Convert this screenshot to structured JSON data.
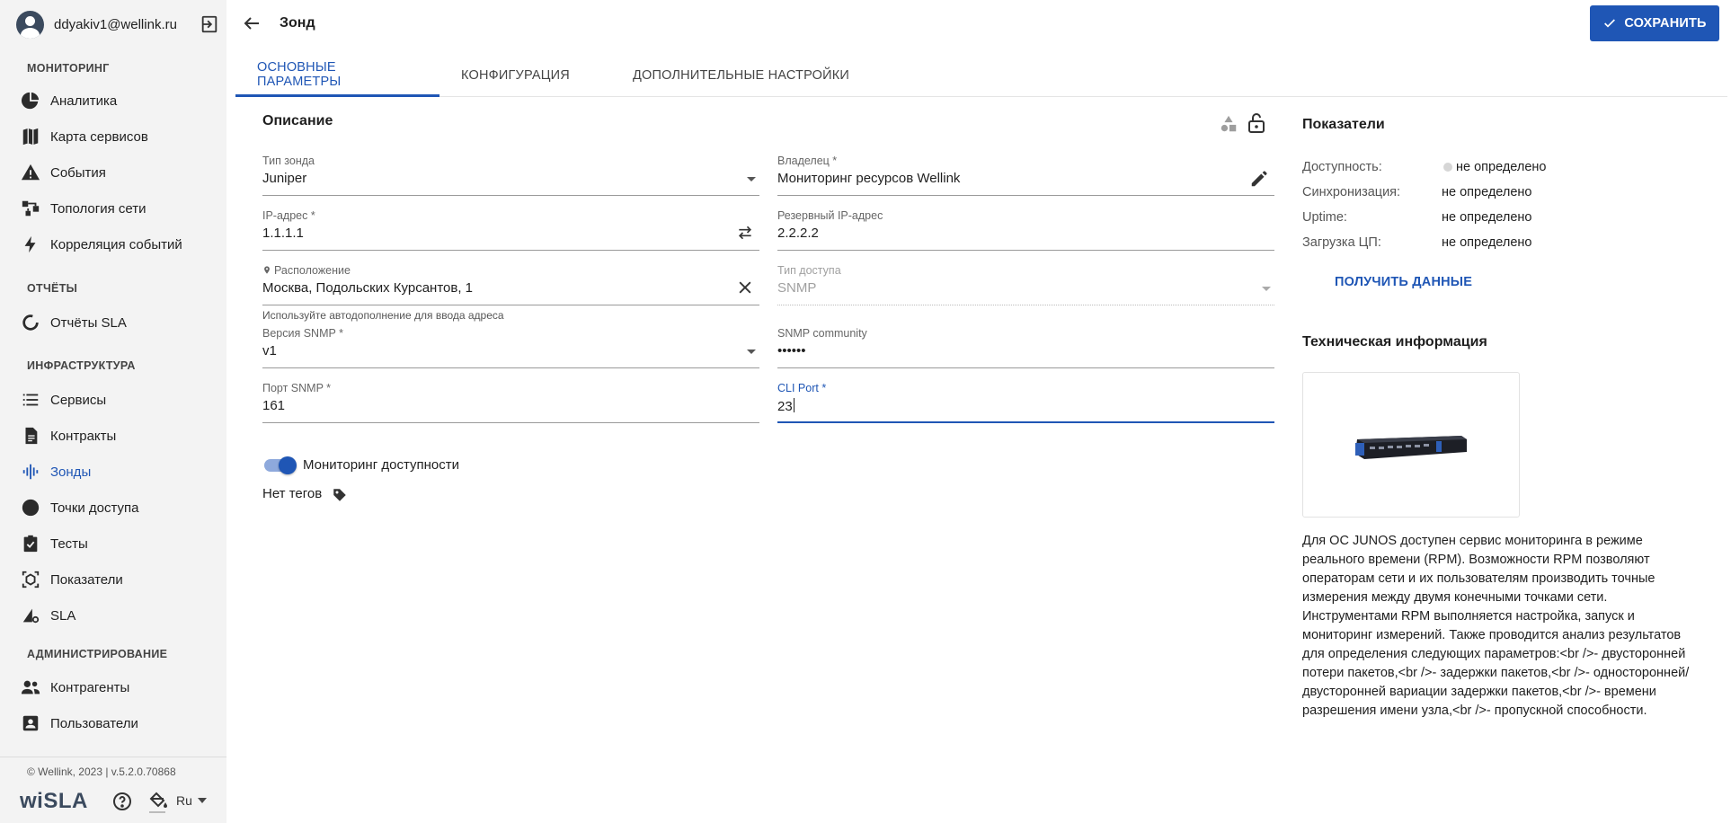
{
  "user": {
    "email": "ddyakiv1@wellink.ru"
  },
  "sidebar": {
    "sections": [
      {
        "title": "МОНИТОРИНГ",
        "items": [
          {
            "label": "Аналитика",
            "icon": "pie-chart-icon"
          },
          {
            "label": "Карта сервисов",
            "icon": "map-icon"
          },
          {
            "label": "События",
            "icon": "warning-icon"
          },
          {
            "label": "Топология сети",
            "icon": "topology-icon"
          },
          {
            "label": "Корреляция событий",
            "icon": "lightning-icon"
          }
        ]
      },
      {
        "title": "ОТЧЁТЫ",
        "items": [
          {
            "label": "Отчёты SLA",
            "icon": "donut-chart-icon"
          }
        ]
      },
      {
        "title": "ИНФРАСТРУКТУРА",
        "items": [
          {
            "label": "Сервисы",
            "icon": "list-icon"
          },
          {
            "label": "Контракты",
            "icon": "document-icon"
          },
          {
            "label": "Зонды",
            "icon": "probe-icon",
            "active": true
          },
          {
            "label": "Точки доступа",
            "icon": "circle-icon"
          },
          {
            "label": "Тесты",
            "icon": "clipboard-check-icon"
          },
          {
            "label": "Показатели",
            "icon": "metrics-icon"
          },
          {
            "label": "SLA",
            "icon": "sla-icon"
          }
        ]
      },
      {
        "title": "АДМИНИСТРИРОВАНИЕ",
        "items": [
          {
            "label": "Контрагенты",
            "icon": "people-icon"
          },
          {
            "label": "Пользователи",
            "icon": "user-card-icon"
          }
        ]
      }
    ],
    "copyright": "© Wellink, 2023 | v.5.2.0.70868",
    "brand": "wiSLA",
    "language": "Ru"
  },
  "header": {
    "title": "Зонд",
    "save_label": "СОХРАНИТЬ"
  },
  "tabs": [
    {
      "label": "ОСНОВНЫЕ ПАРАМЕТРЫ",
      "active": true
    },
    {
      "label": "КОНФИГУРАЦИЯ"
    },
    {
      "label": "ДОПОЛНИТЕЛЬНЫЕ НАСТРОЙКИ"
    }
  ],
  "description": {
    "title": "Описание",
    "fields": {
      "probe_type": {
        "label": "Тип зонда",
        "value": "Juniper"
      },
      "owner": {
        "label": "Владелец *",
        "value": "Мониторинг ресурсов Wellink"
      },
      "ip": {
        "label": "IP-адрес *",
        "value": "1.1.1.1"
      },
      "backup_ip": {
        "label": "Резервный IP-адрес",
        "value": "2.2.2.2"
      },
      "location": {
        "label": "Расположение",
        "value": "Москва, Подольских Курсантов, 1"
      },
      "access_type": {
        "label": "Тип доступа",
        "value": "SNMP"
      },
      "snmp_version": {
        "label": "Версия SNMP *",
        "value": "v1"
      },
      "snmp_community": {
        "label": "SNMP community",
        "value": "••••••"
      },
      "snmp_port": {
        "label": "Порт SNMP *",
        "value": "161"
      },
      "cli_port": {
        "label": "CLI Port *",
        "value": "23"
      }
    },
    "location_hint": "Используйте автодополнение для ввода адреса",
    "availability_toggle": {
      "label": "Мониторинг доступности",
      "on": true
    },
    "tags_label": "Нет тегов"
  },
  "metrics": {
    "title": "Показатели",
    "rows": [
      {
        "label": "Доступность:",
        "value": "не определено"
      },
      {
        "label": "Синхронизация:",
        "value": "не определено"
      },
      {
        "label": "Uptime:",
        "value": "не определено"
      },
      {
        "label": "Загрузка ЦП:",
        "value": "не определено"
      }
    ],
    "get_data_label": "ПОЛУЧИТЬ ДАННЫЕ"
  },
  "tech_info": {
    "title": "Техническая информация",
    "text": "Для ОС JUNOS доступен сервис мониторинга в режиме реального времени (RPM). Возможности RPM позволяют операторам сети и их пользователям производить точные измерения между двумя конечными точками сети. Инструментами RPM выполняется настройка, запуск и мониторинг измерений. Также проводится анализ результатов для определения следующих параметров:<br />- двусторонней потери пакетов,<br />- задержки пакетов,<br />- односторонней/двусторонней вариации задержки пакетов,<br />- времени разрешения имени узла,<br />- пропускной способности."
  },
  "colors": {
    "accent": "#1f56b5",
    "sidebar_bg": "#f3f3f3"
  }
}
